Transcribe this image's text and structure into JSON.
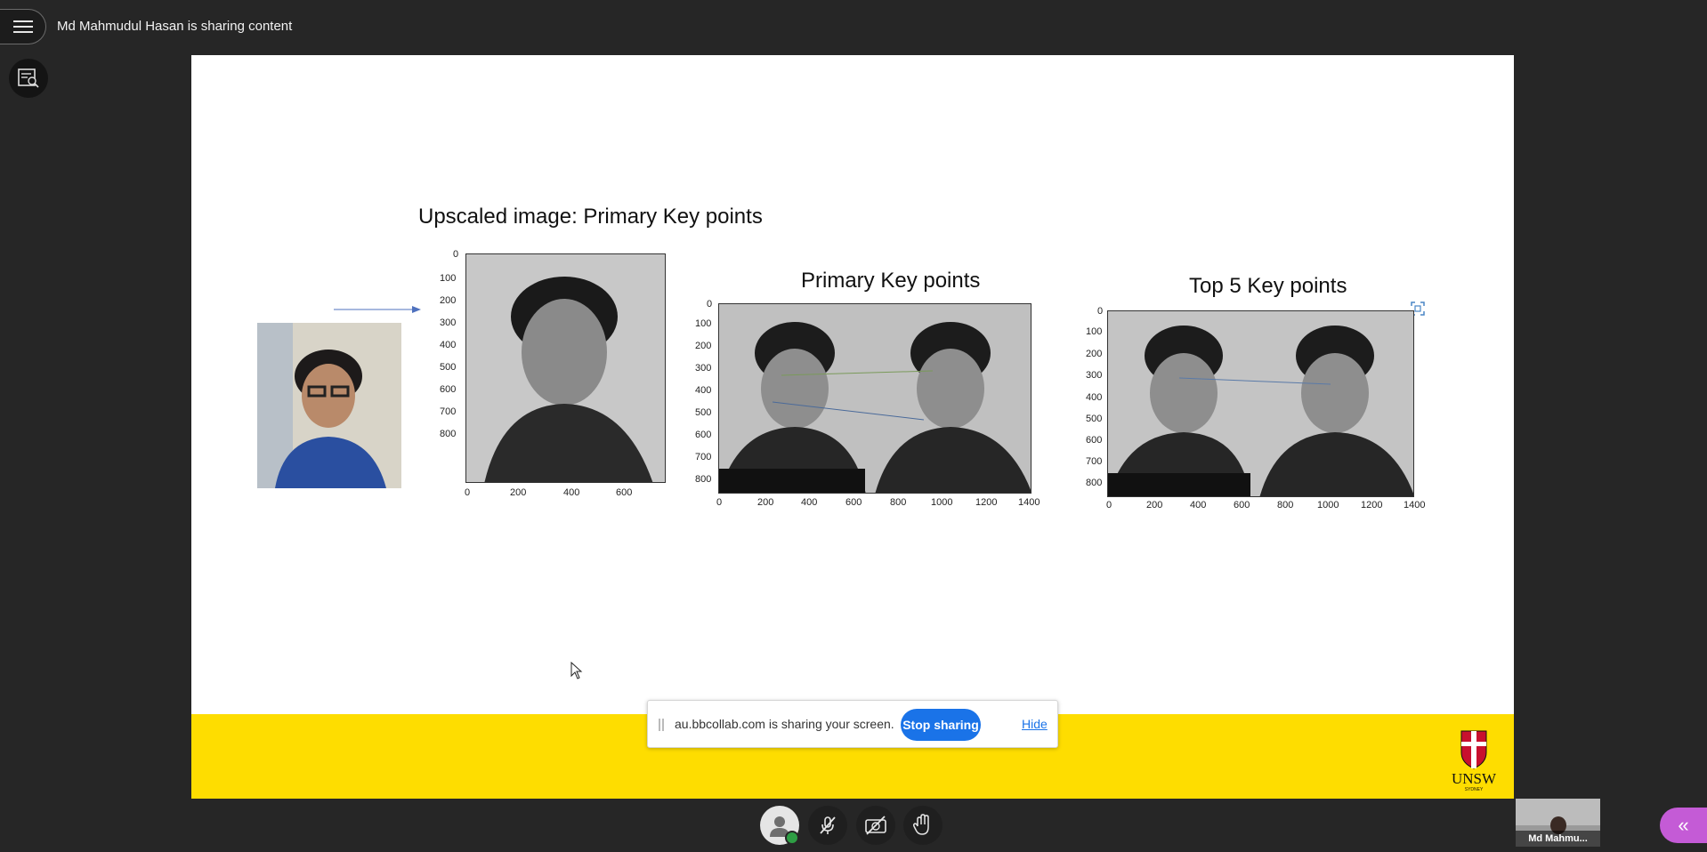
{
  "header": {
    "sharing_title": "Md Mahmudul Hasan is sharing content"
  },
  "slide": {
    "heading": "Upscaled image: Primary Key points",
    "plots": [
      {
        "title": "",
        "y_ticks": [
          "0",
          "100",
          "200",
          "300",
          "400",
          "500",
          "600",
          "700",
          "800"
        ],
        "x_ticks": [
          "0",
          "200",
          "400",
          "600"
        ]
      },
      {
        "title": "Primary Key points",
        "y_ticks": [
          "0",
          "100",
          "200",
          "300",
          "400",
          "500",
          "600",
          "700",
          "800"
        ],
        "x_ticks": [
          "0",
          "200",
          "400",
          "600",
          "800",
          "1000",
          "1200",
          "1400"
        ]
      },
      {
        "title": "Top 5 Key points",
        "y_ticks": [
          "0",
          "100",
          "200",
          "300",
          "400",
          "500",
          "600",
          "700",
          "800"
        ],
        "x_ticks": [
          "0",
          "200",
          "400",
          "600",
          "800",
          "1000",
          "1200",
          "1400"
        ]
      }
    ],
    "logo_text": "UNSW",
    "logo_sub": "SYDNEY"
  },
  "share_bar": {
    "message": "au.bbcollab.com is sharing your screen.",
    "stop_label": "Stop sharing",
    "hide_label": "Hide"
  },
  "self_view": {
    "name": "Md Mahmu..."
  },
  "colors": {
    "slide_footer": "#fedd00",
    "stop_button": "#1a73e8",
    "panel_button": "#c45bd6",
    "status_ok": "#2e9e44"
  },
  "icons": [
    "menu-icon",
    "captions-icon",
    "avatar-icon",
    "mic-off-icon",
    "camera-off-icon",
    "raise-hand-icon",
    "chevron-left-icon",
    "drag-handle-icon"
  ]
}
